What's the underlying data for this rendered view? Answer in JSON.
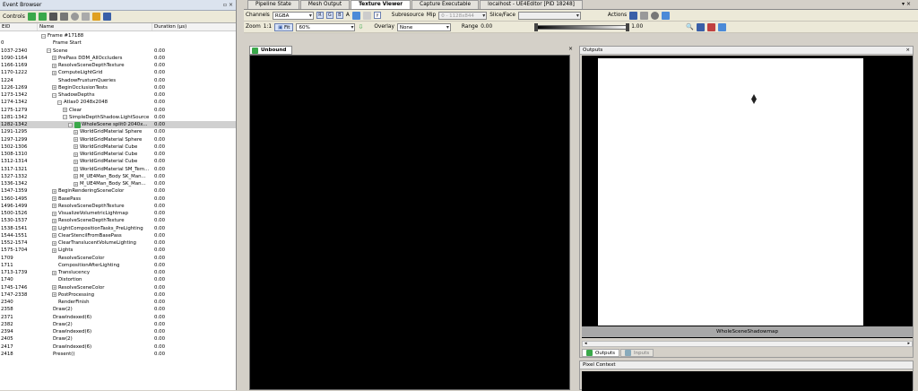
{
  "event_browser": {
    "title": "Event Browser",
    "controls_label": "Controls",
    "columns": {
      "eid": "EID",
      "name": "Name",
      "duration": "Duration (µs)"
    },
    "rows": [
      {
        "eid": "",
        "name": "Frame #17188",
        "dur": "",
        "indent": 0,
        "exp": "-"
      },
      {
        "eid": "0",
        "name": "Frame Start",
        "dur": "",
        "indent": 1,
        "exp": ""
      },
      {
        "eid": "1037-2340",
        "name": "Scene",
        "dur": "0.00",
        "indent": 1,
        "exp": "-"
      },
      {
        "eid": "1090-1164",
        "name": "PrePass DDM_AllOccluders",
        "dur": "0.00",
        "indent": 2,
        "exp": "+"
      },
      {
        "eid": "1166-1169",
        "name": "ResolveSceneDepthTexture",
        "dur": "0.00",
        "indent": 2,
        "exp": "+"
      },
      {
        "eid": "1170-1222",
        "name": "ComputeLightGrid",
        "dur": "0.00",
        "indent": 2,
        "exp": "+"
      },
      {
        "eid": "1224",
        "name": "ShadowFrustumQueries",
        "dur": "0.00",
        "indent": 2,
        "exp": ""
      },
      {
        "eid": "1226-1269",
        "name": "BeginOcclusionTests",
        "dur": "0.00",
        "indent": 2,
        "exp": "+"
      },
      {
        "eid": "1273-1342",
        "name": "ShadowDepths",
        "dur": "0.00",
        "indent": 2,
        "exp": "-"
      },
      {
        "eid": "1274-1342",
        "name": "Atlas0 2048x2048",
        "dur": "0.00",
        "indent": 3,
        "exp": "-"
      },
      {
        "eid": "1275-1279",
        "name": "Clear",
        "dur": "0.00",
        "indent": 4,
        "exp": "+"
      },
      {
        "eid": "1281-1342",
        "name": "SimpleDepthShadow.LightSource",
        "dur": "0.00",
        "indent": 4,
        "exp": "-"
      },
      {
        "eid": "1282-1342",
        "name": "WholeScene split0 2040x...",
        "dur": "0.00",
        "indent": 5,
        "exp": "-",
        "sel": true,
        "icon": "bookmark-icon"
      },
      {
        "eid": "1291-1295",
        "name": "WorldGridMaterial Sphere",
        "dur": "0.00",
        "indent": 6,
        "exp": "+"
      },
      {
        "eid": "1297-1299",
        "name": "WorldGridMaterial Sphere",
        "dur": "0.00",
        "indent": 6,
        "exp": "+"
      },
      {
        "eid": "1302-1306",
        "name": "WorldGridMaterial Cube",
        "dur": "0.00",
        "indent": 6,
        "exp": "+"
      },
      {
        "eid": "1308-1310",
        "name": "WorldGridMaterial Cube",
        "dur": "0.00",
        "indent": 6,
        "exp": "+"
      },
      {
        "eid": "1312-1314",
        "name": "WorldGridMaterial Cube",
        "dur": "0.00",
        "indent": 6,
        "exp": "+"
      },
      {
        "eid": "1317-1321",
        "name": "WorldGridMaterial SM_Tem...",
        "dur": "0.00",
        "indent": 6,
        "exp": "+"
      },
      {
        "eid": "1327-1332",
        "name": "M_UE4Man_Body SK_Man...",
        "dur": "0.00",
        "indent": 6,
        "exp": "+"
      },
      {
        "eid": "1336-1342",
        "name": "M_UE4Man_Body SK_Man...",
        "dur": "0.00",
        "indent": 6,
        "exp": "+"
      },
      {
        "eid": "1347-1359",
        "name": "BeginRenderingSceneColor",
        "dur": "0.00",
        "indent": 2,
        "exp": "+"
      },
      {
        "eid": "1360-1495",
        "name": "BasePass",
        "dur": "0.00",
        "indent": 2,
        "exp": "+"
      },
      {
        "eid": "1496-1499",
        "name": "ResolveSceneDepthTexture",
        "dur": "0.00",
        "indent": 2,
        "exp": "+"
      },
      {
        "eid": "1500-1526",
        "name": "VisualizeVolumetricLightmap",
        "dur": "0.00",
        "indent": 2,
        "exp": "+"
      },
      {
        "eid": "1530-1537",
        "name": "ResolveSceneDepthTexture",
        "dur": "0.00",
        "indent": 2,
        "exp": "+"
      },
      {
        "eid": "1538-1541",
        "name": "LightCompositionTasks_PreLighting",
        "dur": "0.00",
        "indent": 2,
        "exp": "+"
      },
      {
        "eid": "1544-1551",
        "name": "ClearStencilFromBasePass",
        "dur": "0.00",
        "indent": 2,
        "exp": "+"
      },
      {
        "eid": "1552-1574",
        "name": "ClearTranslucentVolumeLighting",
        "dur": "0.00",
        "indent": 2,
        "exp": "+"
      },
      {
        "eid": "1575-1704",
        "name": "Lights",
        "dur": "0.00",
        "indent": 2,
        "exp": "+"
      },
      {
        "eid": "1709",
        "name": "ResolveSceneColor",
        "dur": "0.00",
        "indent": 2,
        "exp": ""
      },
      {
        "eid": "1711",
        "name": "CompositionAfterLighting",
        "dur": "0.00",
        "indent": 2,
        "exp": ""
      },
      {
        "eid": "1713-1739",
        "name": "Translucency",
        "dur": "0.00",
        "indent": 2,
        "exp": "+"
      },
      {
        "eid": "1740",
        "name": "Distortion",
        "dur": "0.00",
        "indent": 2,
        "exp": ""
      },
      {
        "eid": "1745-1746",
        "name": "ResolveSceneColor",
        "dur": "0.00",
        "indent": 2,
        "exp": "+"
      },
      {
        "eid": "1747-2338",
        "name": "PostProcessing",
        "dur": "0.00",
        "indent": 2,
        "exp": "+"
      },
      {
        "eid": "2340",
        "name": "RenderFinish",
        "dur": "0.00",
        "indent": 2,
        "exp": ""
      },
      {
        "eid": "2358",
        "name": "Draw(2)",
        "dur": "0.00",
        "indent": 1,
        "exp": ""
      },
      {
        "eid": "2371",
        "name": "DrawIndexed(6)",
        "dur": "0.00",
        "indent": 1,
        "exp": ""
      },
      {
        "eid": "2382",
        "name": "Draw(2)",
        "dur": "0.00",
        "indent": 1,
        "exp": ""
      },
      {
        "eid": "2394",
        "name": "DrawIndexed(6)",
        "dur": "0.00",
        "indent": 1,
        "exp": ""
      },
      {
        "eid": "2405",
        "name": "Draw(2)",
        "dur": "0.00",
        "indent": 1,
        "exp": ""
      },
      {
        "eid": "2417",
        "name": "DrawIndexed(6)",
        "dur": "0.00",
        "indent": 1,
        "exp": ""
      },
      {
        "eid": "2418",
        "name": "Present()",
        "dur": "0.00",
        "indent": 1,
        "exp": ""
      }
    ]
  },
  "tabs": [
    "Pipeline State",
    "Mesh Output",
    "Texture Viewer",
    "Capture Executable",
    "localhost - UE4Editor [PID 18248]"
  ],
  "active_tab": 2,
  "toolbar": {
    "channels_label": "Channels",
    "channels_value": "RGBA",
    "ch_r": "R",
    "ch_g": "G",
    "ch_b": "B",
    "ch_a": "A",
    "gamma": "γ",
    "subresource_label": "Subresource",
    "mip_label": "Mip",
    "mip_value": "0 - 1128x844",
    "slice_label": "Slice/Face",
    "slice_value": "",
    "actions_label": "Actions",
    "zoom_label": "Zoom",
    "zoom_ratio": "1:1",
    "fit_label": "Fit",
    "zoom_value": "60%",
    "overlay_label": "Overlay",
    "overlay_value": "None",
    "range_label": "Range",
    "range_min": "0.00",
    "range_max": "1.00"
  },
  "viewer": {
    "tab_label": "Unbound"
  },
  "outputs": {
    "title": "Outputs",
    "thumbnail_label": "WholeSceneShadowmap",
    "bottom_tabs": [
      "Outputs",
      "Inputs"
    ]
  },
  "pixel_context": {
    "title": "Pixel Context"
  },
  "colors": {
    "accent": "#d6e2f8",
    "panel": "#d4d0c8"
  }
}
